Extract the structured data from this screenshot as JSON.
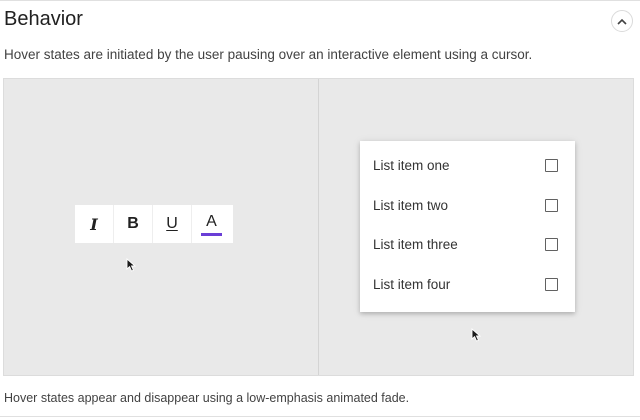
{
  "section": {
    "title": "Behavior",
    "description": "Hover states are initiated by the user pausing over an interactive element using a cursor.",
    "collapse_icon": "chevron-up-icon"
  },
  "toolbar": {
    "buttons": [
      {
        "name": "italic",
        "glyph": "I",
        "icon": "italic-icon"
      },
      {
        "name": "bold",
        "glyph": "B",
        "icon": "bold-icon"
      },
      {
        "name": "underline",
        "glyph": "U",
        "icon": "underline-icon"
      },
      {
        "name": "text-color",
        "glyph": "A",
        "icon": "text-color-icon"
      }
    ],
    "text_color_accent": "#6a3ed6"
  },
  "menu": {
    "items": [
      {
        "label": "List item one"
      },
      {
        "label": "List item two"
      },
      {
        "label": "List item three"
      },
      {
        "label": "List item four"
      }
    ]
  },
  "footnote": "Hover states appear and disappear using a low-emphasis animated fade.",
  "colors": {
    "demo_background": "#e9e9e9",
    "surface": "#ffffff"
  }
}
